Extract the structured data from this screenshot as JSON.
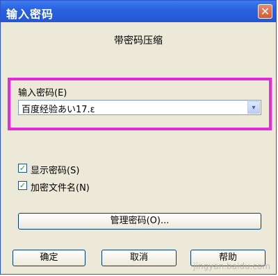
{
  "window": {
    "title": "输入密码",
    "close_glyph": "✕"
  },
  "header": {
    "subtitle": "带密码压缩"
  },
  "password": {
    "label": "输入密码",
    "label_accel": "(E)",
    "value": "百度经验あい17.ε",
    "dropdown_glyph": "▾"
  },
  "options": {
    "show_password": {
      "label": "显示密码",
      "accel": "(S)",
      "checked": true
    },
    "encrypt_filenames": {
      "label": "加密文件名",
      "accel": "(N)",
      "checked": true
    }
  },
  "buttons": {
    "manage": "管理密码(O)...",
    "ok": "确定",
    "cancel": "取消",
    "help": "帮助"
  },
  "watermark": "jingyan.baidu.com",
  "colors": {
    "titlebar": "#2356d4",
    "highlight": "#e02bd6",
    "dialog_bg": "#ece9d8"
  }
}
